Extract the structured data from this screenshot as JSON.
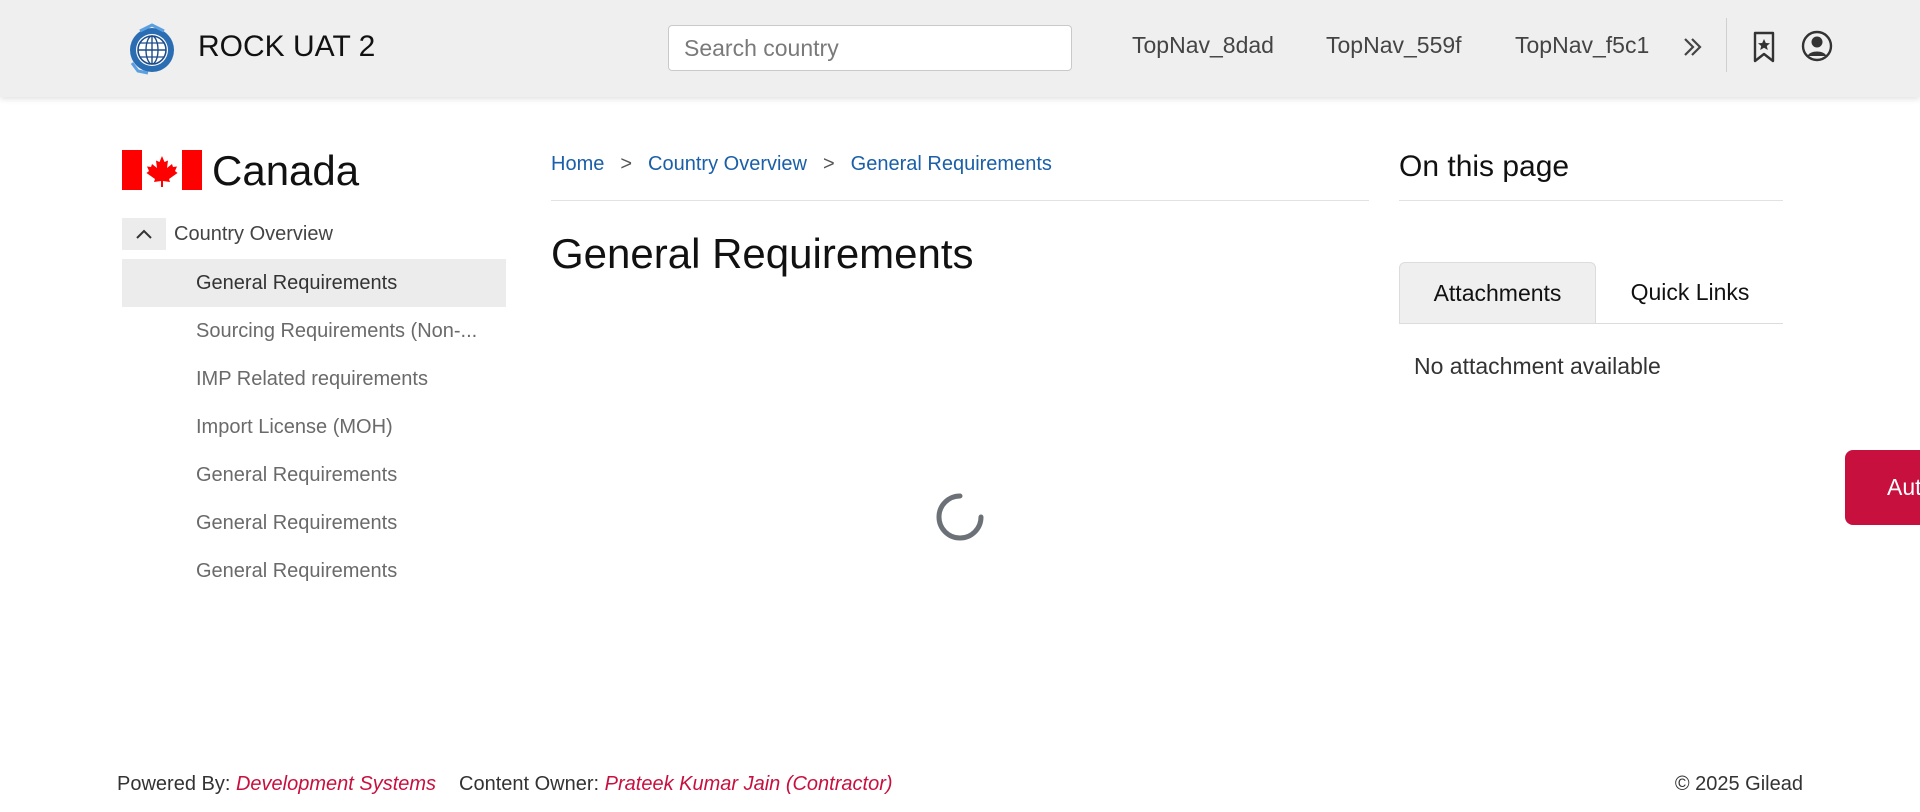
{
  "header": {
    "app_title": "ROCK UAT 2",
    "search_placeholder": "Search country",
    "search_value": "",
    "nav_items": [
      "TopNav_8dad",
      "TopNav_559f",
      "TopNav_f5c1"
    ],
    "icons": [
      "globe-logo-icon",
      "double-chevron-right-icon",
      "bookmark-star-icon",
      "user-profile-icon"
    ]
  },
  "sidebar": {
    "country": "Canada",
    "section_label": "Country Overview",
    "items": [
      {
        "label": "General Requirements",
        "active": true
      },
      {
        "label": "Sourcing Requirements (Non-...",
        "active": false
      },
      {
        "label": "IMP Related requirements",
        "active": false
      },
      {
        "label": "Import License (MOH)",
        "active": false
      },
      {
        "label": "General Requirements",
        "active": false
      },
      {
        "label": "General Requirements",
        "active": false
      },
      {
        "label": "General Requirements",
        "active": false
      }
    ]
  },
  "breadcrumb": {
    "items": [
      "Home",
      "Country Overview",
      "General Requirements"
    ],
    "separator": ">"
  },
  "main": {
    "title": "General Requirements",
    "loading": true
  },
  "right_panel": {
    "title": "On this page",
    "tabs": [
      {
        "label": "Attachments",
        "active": true
      },
      {
        "label": "Quick Links",
        "active": false
      }
    ],
    "empty_message": "No attachment available"
  },
  "floating_tab": {
    "label": "Aut"
  },
  "footer": {
    "powered_by_label": "Powered By:",
    "powered_by_value": "Development Systems",
    "owner_label": "Content Owner:",
    "owner_value": "Prateek Kumar Jain (Contractor)",
    "copyright": "© 2025 Gilead"
  },
  "colors": {
    "header_bg": "#efefef",
    "link_blue": "#1a5fa8",
    "brand_red": "#c8103e",
    "flag_red": "#ff0000"
  }
}
